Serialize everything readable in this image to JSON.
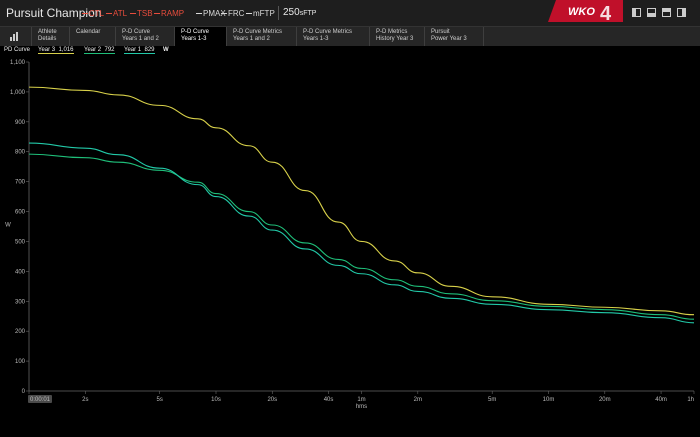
{
  "athlete_name": "Pursuit Champion",
  "metrics": [
    {
      "label": "CTL",
      "color": "#e74c3c"
    },
    {
      "label": "ATL",
      "color": "#e74c3c"
    },
    {
      "label": "TSB",
      "color": "#e74c3c"
    },
    {
      "label": "RAMP",
      "color": "#e74c3c"
    },
    {
      "label": "PMAX",
      "color": "#d8d8d8"
    },
    {
      "label": "FRC",
      "color": "#d8d8d8"
    },
    {
      "label": "mFTP",
      "color": "#d8d8d8"
    }
  ],
  "sftp": {
    "value": "250",
    "unit": "sFTP"
  },
  "logo": {
    "text": "WKO",
    "version": "4",
    "color": "#c0102a"
  },
  "tabs": [
    {
      "line1": "Athlete",
      "line2": "Details",
      "active": false
    },
    {
      "line1": "Calendar",
      "line2": "",
      "active": false
    },
    {
      "line1": "P-D Curve",
      "line2": "Years 1 and 2",
      "active": false
    },
    {
      "line1": "P-D Curve",
      "line2": "Years 1-3",
      "active": true
    },
    {
      "line1": "P-D Curve Metrics",
      "line2": "Years 1 and 2",
      "active": false
    },
    {
      "line1": "P-D Curve Metrics",
      "line2": "Years 1-3",
      "active": false
    },
    {
      "line1": "P-D Metrics",
      "line2": "History Year 3",
      "active": false
    },
    {
      "line1": "Pursuit",
      "line2": "Power Year 3",
      "active": false
    }
  ],
  "chart_panel_title": "PD Curve",
  "legend_unit": "W",
  "chart_data": {
    "type": "line",
    "xlabel": "hms",
    "ylabel": "W",
    "x_scale": "log",
    "x_axis_seconds": [
      1,
      3600
    ],
    "xticks": [
      {
        "sec": 1,
        "label": "0:00:01"
      },
      {
        "sec": 2,
        "label": "2s"
      },
      {
        "sec": 5,
        "label": "5s"
      },
      {
        "sec": 10,
        "label": "10s"
      },
      {
        "sec": 20,
        "label": "20s"
      },
      {
        "sec": 40,
        "label": "40s"
      },
      {
        "sec": 60,
        "label": "1m"
      },
      {
        "sec": 120,
        "label": "2m"
      },
      {
        "sec": 300,
        "label": "5m"
      },
      {
        "sec": 600,
        "label": "10m"
      },
      {
        "sec": 1200,
        "label": "20m"
      },
      {
        "sec": 2400,
        "label": "40m"
      },
      {
        "sec": 3600,
        "label": "1h"
      }
    ],
    "ylim": [
      0,
      1100
    ],
    "yticks": [
      0,
      100,
      200,
      300,
      400,
      500,
      600,
      700,
      800,
      900,
      "1,000",
      "1,100"
    ],
    "grid": false,
    "series": [
      {
        "name": "Year 3",
        "legend_value": "1,016",
        "color": "#d8d14a",
        "x": [
          1,
          2,
          3,
          5,
          8,
          10,
          15,
          20,
          30,
          45,
          60,
          90,
          120,
          180,
          300,
          600,
          1200,
          2400,
          3600
        ],
        "y": [
          1016,
          1005,
          990,
          955,
          910,
          880,
          820,
          765,
          670,
          565,
          500,
          435,
          395,
          350,
          315,
          290,
          280,
          268,
          255
        ]
      },
      {
        "name": "Year 2",
        "legend_value": "792",
        "color": "#1fbf7a",
        "x": [
          1,
          2,
          3,
          5,
          8,
          10,
          15,
          20,
          30,
          45,
          60,
          90,
          120,
          180,
          300,
          600,
          1200,
          2400,
          3600
        ],
        "y": [
          792,
          780,
          765,
          738,
          698,
          660,
          600,
          555,
          495,
          440,
          410,
          372,
          350,
          325,
          302,
          283,
          272,
          255,
          240
        ]
      },
      {
        "name": "Year 1",
        "legend_value": "829",
        "color": "#22c9a8",
        "x": [
          1,
          2,
          3,
          5,
          8,
          10,
          15,
          20,
          30,
          45,
          60,
          90,
          120,
          180,
          300,
          600,
          1200,
          2400,
          3600
        ],
        "y": [
          829,
          812,
          790,
          745,
          690,
          650,
          585,
          538,
          475,
          420,
          392,
          355,
          333,
          310,
          290,
          272,
          262,
          245,
          228
        ]
      }
    ]
  }
}
